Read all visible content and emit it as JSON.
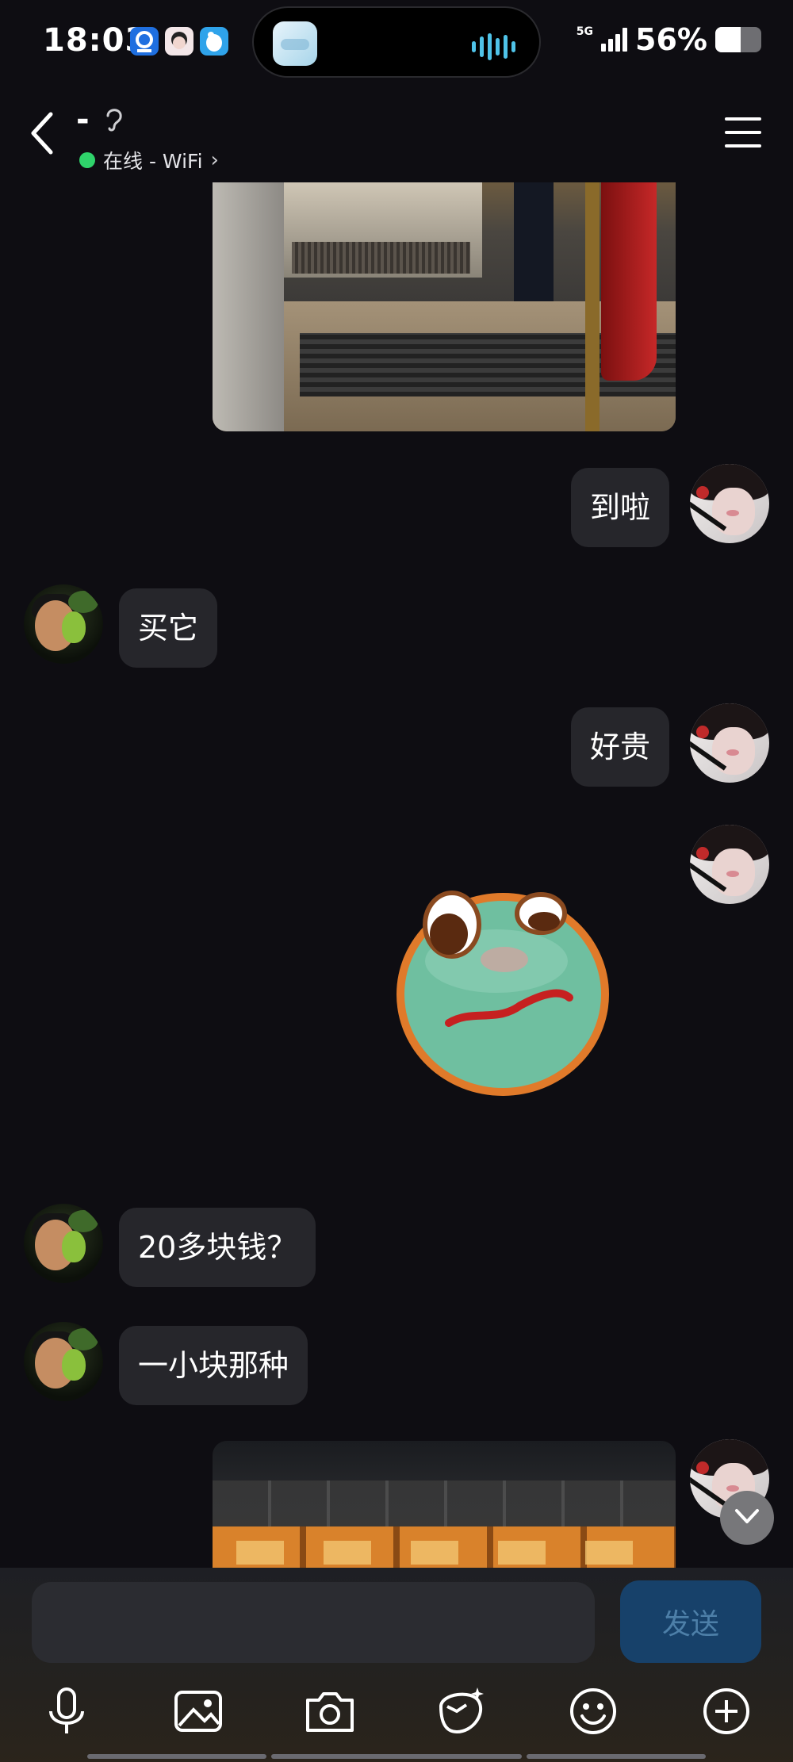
{
  "status_bar": {
    "time": "18:03",
    "network": "5G",
    "battery_percent_label": "56%",
    "battery_level": 0.56,
    "icons": [
      "app-icon-blue",
      "app-icon-avatar",
      "app-icon-bird"
    ]
  },
  "header": {
    "title": "-",
    "status_text": "在线 - WiFi",
    "chevron": "›",
    "online_color": "#2fd36b"
  },
  "messages": [
    {
      "from": "peer",
      "type": "image",
      "description_icon": "bakery-entrance-photo"
    },
    {
      "from": "me",
      "type": "text",
      "text": "到啦"
    },
    {
      "from": "peer",
      "type": "text",
      "text": "买它"
    },
    {
      "from": "me",
      "type": "text",
      "text": "好贵"
    },
    {
      "from": "me",
      "type": "sticker",
      "icon": "green-face-sticker"
    },
    {
      "from": "peer",
      "type": "text",
      "text": "20多块钱？"
    },
    {
      "from": "peer",
      "type": "text",
      "text": "一小块那种"
    },
    {
      "from": "me",
      "type": "image",
      "description_icon": "bread-display-photo"
    }
  ],
  "composer": {
    "placeholder": "",
    "send_label": "发送",
    "send_color": "#17416a"
  },
  "toolbar": {
    "icons": [
      "microphone-icon",
      "image-icon",
      "camera-icon",
      "red-packet-icon",
      "emoji-icon",
      "plus-icon"
    ]
  },
  "colors": {
    "background": "#0e0d12",
    "bubble": "#26262b"
  }
}
